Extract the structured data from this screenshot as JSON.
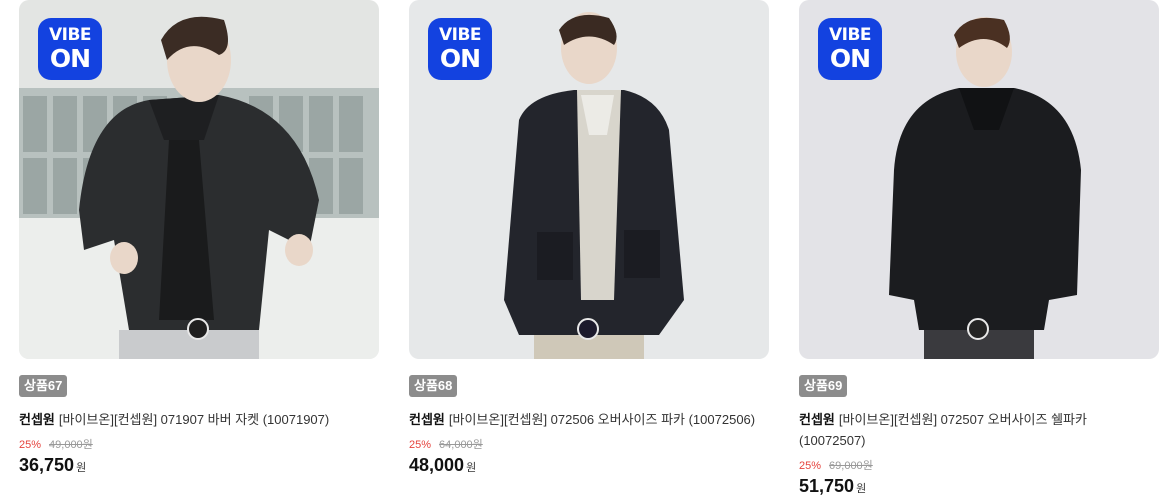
{
  "badge": {
    "line1": "VIBE",
    "line2": "ON"
  },
  "products": [
    {
      "tag": "상품67",
      "brand": "컨셉원",
      "name": "[바이브온][컨셉원] 071907 바버 자켓 (10071907)",
      "discount": "25%",
      "original_price": "49,000원",
      "price": "36,750",
      "currency": "원",
      "swatch_color": "#1f1f1f"
    },
    {
      "tag": "상품68",
      "brand": "컨셉원",
      "name": "[바이브온][컨셉원] 072506 오버사이즈 파카 (10072506)",
      "discount": "25%",
      "original_price": "64,000원",
      "price": "48,000",
      "currency": "원",
      "swatch_color": "#1c1a2c"
    },
    {
      "tag": "상품69",
      "brand": "컨셉원",
      "name": "[바이브온][컨셉원] 072507 오버사이즈 쉘파카 (10072507)",
      "discount": "25%",
      "original_price": "69,000원",
      "price": "51,750",
      "currency": "원",
      "swatch_color": "#242424"
    }
  ]
}
